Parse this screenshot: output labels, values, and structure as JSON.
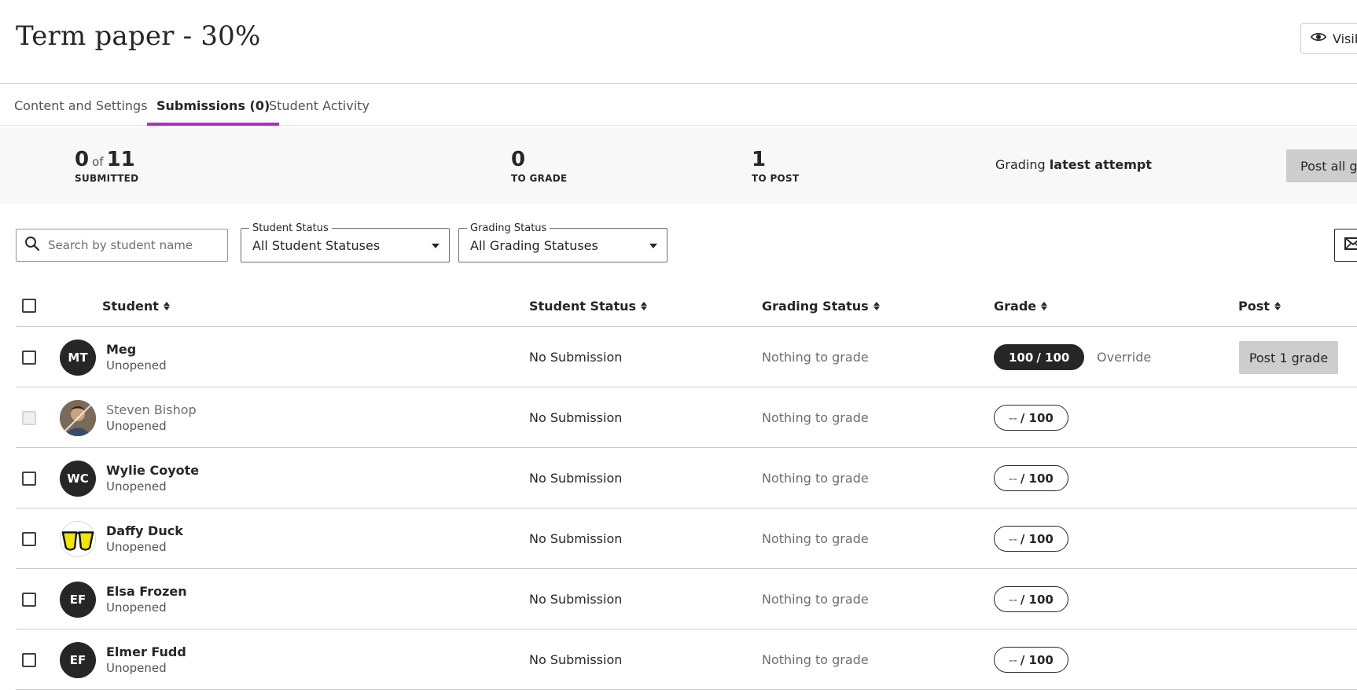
{
  "page": {
    "title": "Term paper - 30%",
    "visibility_label": "Visib"
  },
  "tabs": [
    {
      "label": "Content and Settings",
      "active": false
    },
    {
      "label": "Submissions (0)",
      "active": true
    },
    {
      "label": "Student Activity",
      "active": false
    }
  ],
  "stats": {
    "submitted_count": "0",
    "submitted_of": "of",
    "submitted_total": "11",
    "submitted_label": "SUBMITTED",
    "to_grade_count": "0",
    "to_grade_label": "TO GRADE",
    "to_post_count": "1",
    "to_post_label": "TO POST",
    "grading_prefix": "Grading",
    "grading_mode": "latest attempt",
    "post_all_label": "Post all gra"
  },
  "filters": {
    "search_placeholder": "Search by student name",
    "student_status_legend": "Student Status",
    "student_status_value": "All Student Statuses",
    "grading_status_legend": "Grading Status",
    "grading_status_value": "All Grading Statuses"
  },
  "table": {
    "headers": {
      "student": "Student",
      "student_status": "Student Status",
      "grading_status": "Grading Status",
      "grade": "Grade",
      "post": "Post"
    },
    "rows": [
      {
        "initials": "MT",
        "name": "Meg",
        "sub": "Unopened",
        "status": "No Submission",
        "grading": "Nothing to grade",
        "grade": "100",
        "max": "/ 100",
        "override": "Override",
        "post": "Post 1 grade"
      },
      {
        "initials": "",
        "name": "Steven Bishop",
        "sub": "Unopened",
        "status": "No Submission",
        "grading": "Nothing to grade",
        "grade": "--",
        "max": "/ 100"
      },
      {
        "initials": "WC",
        "name": "Wylie Coyote",
        "sub": "Unopened",
        "status": "No Submission",
        "grading": "Nothing to grade",
        "grade": "--",
        "max": "/ 100"
      },
      {
        "initials": "",
        "name": "Daffy Duck",
        "sub": "Unopened",
        "status": "No Submission",
        "grading": "Nothing to grade",
        "grade": "--",
        "max": "/ 100"
      },
      {
        "initials": "EF",
        "name": "Elsa Frozen",
        "sub": "Unopened",
        "status": "No Submission",
        "grading": "Nothing to grade",
        "grade": "--",
        "max": "/ 100"
      },
      {
        "initials": "EF",
        "name": "Elmer Fudd",
        "sub": "Unopened",
        "status": "No Submission",
        "grading": "Nothing to grade",
        "grade": "--",
        "max": "/ 100"
      }
    ]
  },
  "colors": {
    "tab_accent": "#b32ebf",
    "avatar_bg": "#262626",
    "button_gray": "#cdcdcd"
  }
}
